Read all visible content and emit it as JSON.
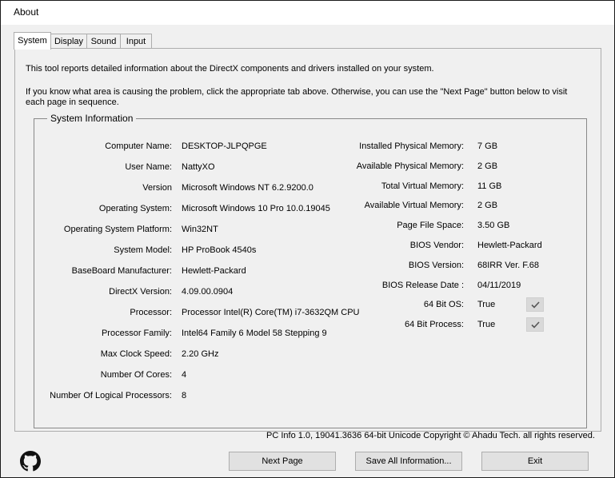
{
  "window": {
    "title": "About"
  },
  "tabs": [
    {
      "label": "System"
    },
    {
      "label": "Display"
    },
    {
      "label": "Sound"
    },
    {
      "label": "Input"
    }
  ],
  "intro": {
    "line1": "This tool reports detailed information about the DirectX components and drivers installed on your system.",
    "line2": "If you know what area is causing the problem, click the appropriate tab above.  Otherwise, you can use the \"Next Page\" button below to visit",
    "line3": "each page in sequence."
  },
  "system_info": {
    "group_label": "System Information",
    "left": [
      {
        "label": "Computer Name:",
        "value": "DESKTOP-JLPQPGE"
      },
      {
        "label": "User Name:",
        "value": "NattyXO"
      },
      {
        "label": "Version",
        "value": "Microsoft Windows NT 6.2.9200.0"
      },
      {
        "label": "Operating System:",
        "value": "Microsoft Windows 10 Pro 10.0.19045"
      },
      {
        "label": "Operating System Platform:",
        "value": "Win32NT"
      },
      {
        "label": "System Model:",
        "value": "HP ProBook 4540s"
      },
      {
        "label": "BaseBoard Manufacturer:",
        "value": "Hewlett-Packard"
      },
      {
        "label": "DirectX Version:",
        "value": "4.09.00.0904"
      },
      {
        "label": "Processor:",
        "value": "Processor Intel(R) Core(TM) i7-3632QM CPU"
      },
      {
        "label": "Processor Family:",
        "value": "Intel64 Family 6 Model 58 Stepping 9"
      },
      {
        "label": "Max Clock Speed:",
        "value": "2.20 GHz"
      },
      {
        "label": "Number Of Cores:",
        "value": "4"
      },
      {
        "label": "Number Of Logical Processors:",
        "value": "8"
      }
    ],
    "right": [
      {
        "label": "Installed Physical Memory:",
        "value": "7 GB"
      },
      {
        "label": "Available Physical Memory:",
        "value": "2 GB"
      },
      {
        "label": "Total Virtual Memory:",
        "value": "11 GB"
      },
      {
        "label": "Available Virtual Memory:",
        "value": "2 GB"
      },
      {
        "label": "Page File Space:",
        "value": "3.50 GB"
      },
      {
        "label": "BIOS Vendor:",
        "value": "Hewlett-Packard"
      },
      {
        "label": "BIOS Version:",
        "value": "68IRR Ver. F.68"
      },
      {
        "label": "BIOS Release Date :",
        "value": "04/11/2019"
      },
      {
        "label": "64 Bit OS:",
        "value": "True",
        "checked": true
      },
      {
        "label": "64 Bit Process:",
        "value": "True",
        "checked": true
      }
    ]
  },
  "footer": {
    "copyright": "PC Info 1.0, 19041.3636 64-bit Unicode Copyright © Ahadu Tech. all rights reserved.",
    "next_page_label": "Next Page",
    "save_all_label": "Save All Information...",
    "exit_label": "Exit",
    "logo_icon": "github-icon"
  }
}
